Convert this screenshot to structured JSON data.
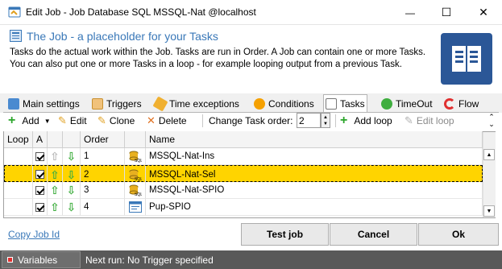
{
  "window": {
    "title": "Edit Job - Job Database SQL MSSQL-Nat @localhost",
    "minimize_glyph": "—",
    "maximize_glyph": "☐",
    "close_glyph": "✕"
  },
  "header": {
    "title": "The Job - a placeholder for your Tasks",
    "description_line1": "Tasks do the actual work within the Job. Tasks are run in Order. A Job can contain one or more Tasks.",
    "description_line2": "You can also put one or more Tasks in a loop - for example looping output from a previous Task."
  },
  "tabs": [
    {
      "label": "Main settings",
      "icon": "main-settings-icon"
    },
    {
      "label": "Triggers",
      "icon": "triggers-icon"
    },
    {
      "label": "Time exceptions",
      "icon": "time-exceptions-icon"
    },
    {
      "label": "Conditions",
      "icon": "conditions-icon"
    },
    {
      "label": "Tasks",
      "icon": "tasks-icon",
      "active": true
    },
    {
      "label": "TimeOut",
      "icon": "timeout-icon"
    },
    {
      "label": "Flow",
      "icon": "flow-icon"
    }
  ],
  "toolbar": {
    "add_label": "Add",
    "edit_label": "Edit",
    "clone_label": "Clone",
    "delete_label": "Delete",
    "change_order_label": "Change Task order:",
    "order_value": "2",
    "add_loop_label": "Add loop",
    "edit_loop_label": "Edit loop"
  },
  "grid": {
    "columns": [
      "Loop",
      "A",
      "",
      "",
      "Order",
      "",
      "Name"
    ],
    "rows": [
      {
        "order": "1",
        "name": "MSSQL-Nat-Ins",
        "active": true,
        "icon": "sql-task-icon",
        "selected": false
      },
      {
        "order": "2",
        "name": "MSSQL-Nat-Sel",
        "active": true,
        "icon": "sql-task-icon",
        "selected": true
      },
      {
        "order": "3",
        "name": "MSSQL-Nat-SPIO",
        "active": true,
        "icon": "sql-task-icon",
        "selected": false
      },
      {
        "order": "4",
        "name": "Pup-SPIO",
        "active": true,
        "icon": "window-task-icon",
        "selected": false
      }
    ]
  },
  "footer": {
    "copy_job_id": "Copy Job Id",
    "test_job": "Test job",
    "cancel": "Cancel",
    "ok": "Ok"
  },
  "statusbar": {
    "variables": "Variables",
    "next_run": "Next run: No Trigger specified"
  },
  "colors": {
    "accent": "#3a78b8",
    "selected_row": "#ffd400",
    "statusbar": "#595959",
    "book_icon": "#2b5797"
  }
}
